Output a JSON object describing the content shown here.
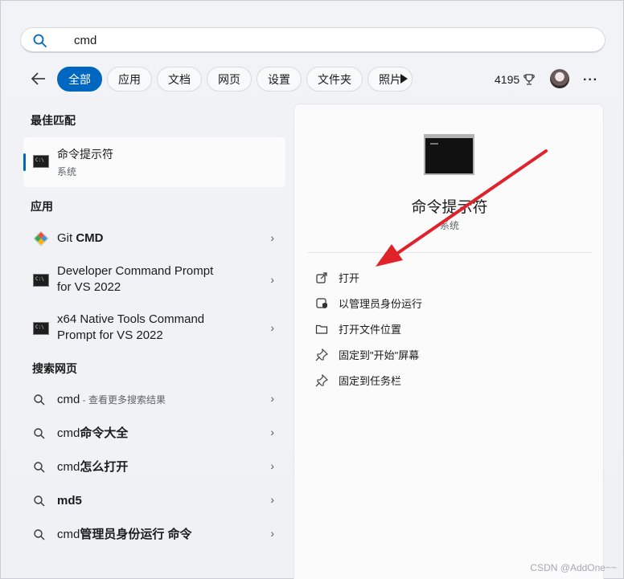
{
  "search": {
    "value": "cmd",
    "placeholder": ""
  },
  "filters": {
    "chips": [
      "全部",
      "应用",
      "文档",
      "网页",
      "设置",
      "文件夹",
      "照片"
    ],
    "active_index": 0
  },
  "header": {
    "points": "4195"
  },
  "best_match": {
    "heading": "最佳匹配",
    "name": "命令提示符",
    "type": "系统"
  },
  "apps": {
    "heading": "应用",
    "items": [
      {
        "prefix": "Git ",
        "bold": "CMD",
        "line2": ""
      },
      {
        "prefix": "Developer Command Prompt",
        "bold": "",
        "line2": "for VS 2022"
      },
      {
        "prefix": "x64 Native Tools Command",
        "bold": "",
        "line2": "Prompt for VS 2022"
      }
    ]
  },
  "web": {
    "heading": "搜索网页",
    "items": [
      {
        "prefix": "cmd",
        "bold": "",
        "suffix": " - 查看更多搜索结果"
      },
      {
        "prefix": "cmd",
        "bold": "命令大全",
        "suffix": ""
      },
      {
        "prefix": "cmd",
        "bold": "怎么打开",
        "suffix": ""
      },
      {
        "prefix": "",
        "bold": "md5",
        "suffix": ""
      },
      {
        "prefix": "cmd",
        "bold": "管理员身份运行 命令",
        "suffix": ""
      }
    ]
  },
  "detail": {
    "title": "命令提示符",
    "subtitle": "系统",
    "actions": [
      "打开",
      "以管理员身份运行",
      "打开文件位置",
      "固定到\"开始\"屏幕",
      "固定到任务栏"
    ]
  },
  "watermark": "CSDN @AddOne~~",
  "colors": {
    "accent": "#0067c0",
    "arrow": "#e0232a"
  }
}
